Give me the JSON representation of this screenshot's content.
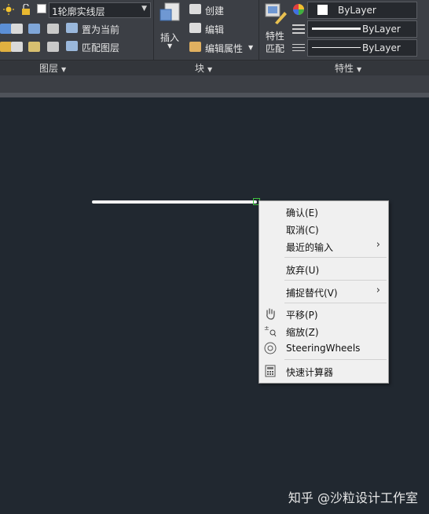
{
  "ribbon": {
    "layer_combo_value": "1轮廓实线层",
    "layer_buttons": {
      "set_current": "置为当前",
      "match_layer": "匹配图层"
    },
    "block_buttons": {
      "insert": "插入",
      "create": "创建",
      "edit": "编辑",
      "edit_attributes": "编辑属性"
    },
    "properties": {
      "match_properties": "特性\n匹配",
      "color": "ByLayer",
      "linetype": "ByLayer",
      "lineweight": "ByLayer"
    },
    "panel_titles": {
      "layers": "图层",
      "block": "块",
      "properties": "特性"
    },
    "colors": {
      "ribbon_bg": "#3c3f45",
      "canvas_bg": "#212830",
      "grip": "#3fc13f"
    }
  },
  "context_menu": {
    "items": [
      {
        "label": "确认(E)"
      },
      {
        "label": "取消(C)"
      },
      {
        "label": "最近的输入",
        "submenu": "›"
      },
      {
        "label": "放弃(U)"
      },
      {
        "label": "捕捉替代(V)",
        "submenu": "›"
      },
      {
        "label": "平移(P)",
        "icon": "pan-hand-icon"
      },
      {
        "label": "缩放(Z)",
        "icon": "zoom-icon"
      },
      {
        "label": "SteeringWheels",
        "icon": "steeringwheels-icon"
      },
      {
        "label": "快速计算器",
        "icon": "calculator-icon"
      }
    ]
  },
  "watermark": "知乎 @沙粒设计工作室"
}
